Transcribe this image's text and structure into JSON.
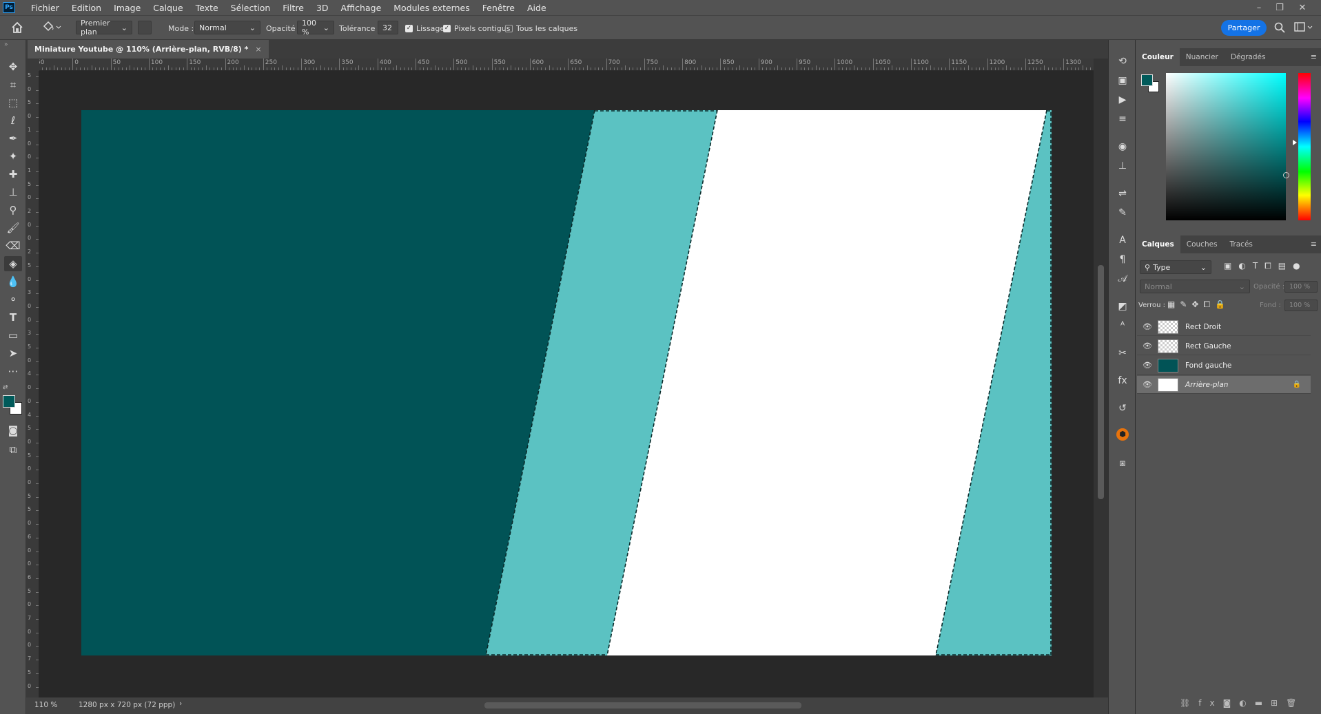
{
  "app": {
    "logo": "Ps"
  },
  "menu": [
    "Fichier",
    "Edition",
    "Image",
    "Calque",
    "Texte",
    "Sélection",
    "Filtre",
    "3D",
    "Affichage",
    "Modules externes",
    "Fenêtre",
    "Aide"
  ],
  "window_controls": {
    "minimize": "–",
    "restore": "❐",
    "close": "✕"
  },
  "options": {
    "fill_source": "Premier plan",
    "mode_label": "Mode :",
    "mode_value": "Normal",
    "opacity_label": "Opacité :",
    "opacity_value": "100 %",
    "tolerance_label": "Tolérance :",
    "tolerance_value": "32",
    "smoothing_label": "Lissage",
    "smoothing_checked": true,
    "contiguous_label": "Pixels contigus",
    "contiguous_checked": true,
    "all_layers_label": "Tous les calques",
    "all_layers_checked": false,
    "share_label": "Partager"
  },
  "document": {
    "tab_title": "Miniature Youtube @ 110% (Arrière-plan, RVB/8) *",
    "close_glyph": "×",
    "zoom": "110 %",
    "dimensions": "1280 px x 720 px (72 ppp)",
    "colors": {
      "dark_teal": "#015356",
      "light_teal": "#5bc2c2",
      "white": "#ffffff"
    }
  },
  "ruler": {
    "h_ticks": [
      "50",
      "0",
      "50",
      "100",
      "150",
      "200",
      "250",
      "300",
      "350",
      "400",
      "450",
      "500",
      "550",
      "600",
      "650",
      "700",
      "750",
      "800",
      "850",
      "900",
      "950",
      "1000",
      "1050",
      "1100",
      "1150",
      "1200",
      "1250",
      "1300"
    ],
    "v_ticks": [
      "5",
      "0",
      "5",
      "0",
      "1",
      "0",
      "0",
      "1",
      "5",
      "0",
      "2",
      "0",
      "0",
      "2",
      "5",
      "0",
      "3",
      "0",
      "0",
      "3",
      "5",
      "0",
      "4",
      "0",
      "0",
      "4",
      "5",
      "0",
      "5",
      "0",
      "0",
      "5",
      "5",
      "0",
      "6",
      "0",
      "0",
      "6",
      "5",
      "0",
      "7",
      "0",
      "0",
      "7",
      "5",
      "0"
    ]
  },
  "color_panel": {
    "tabs": [
      "Couleur",
      "Nuancier",
      "Dégradés"
    ],
    "foreground": "#005a5a",
    "background": "#ffffff",
    "hue": "#00ffff"
  },
  "layers_panel": {
    "tabs": [
      "Calques",
      "Couches",
      "Tracés"
    ],
    "filter_kind": "Type",
    "blend_mode": "Normal",
    "opacity_label": "Opacité :",
    "opacity_value": "100 %",
    "lock_label": "Verrou :",
    "fill_label": "Fond :",
    "fill_value": "100 %",
    "layers": [
      {
        "name": "Rect Droit",
        "thumb": "checker",
        "selected": false,
        "italic": false
      },
      {
        "name": "Rect Gauche",
        "thumb": "checker",
        "selected": false,
        "italic": false
      },
      {
        "name": "Fond gauche",
        "thumb": "teal",
        "selected": false,
        "italic": false
      },
      {
        "name": "Arrière-plan",
        "thumb": "white",
        "selected": true,
        "italic": true,
        "locked": true
      }
    ]
  }
}
